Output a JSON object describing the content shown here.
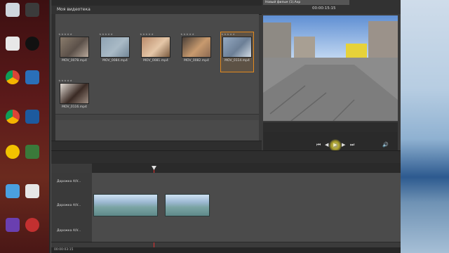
{
  "app": {
    "library_title": "Моя видеотека",
    "player_tab": "Новый фильм (1).Axp",
    "timecode": "00:00:15:15"
  },
  "library": {
    "items": [
      {
        "name": "MOV_0078.mp4",
        "stars": "★★★★★",
        "colors": [
          "#8a7c6c",
          "#5b5049",
          "#b8a89a"
        ]
      },
      {
        "name": "MOV_0084.mp4",
        "stars": "★★★★★",
        "colors": [
          "#8fa3b3",
          "#a9bac6",
          "#738797"
        ]
      },
      {
        "name": "MOV_0081.mp4",
        "stars": "★★★★★",
        "colors": [
          "#b98a6a",
          "#e5c7a8",
          "#7a5a3e"
        ]
      },
      {
        "name": "MOV_0082.mp4",
        "stars": "★★★★★",
        "colors": [
          "#4a3f38",
          "#c89a6e",
          "#8c6a52"
        ]
      },
      {
        "name": "MOV_0114.mp4",
        "stars": "★★★★★",
        "colors": [
          "#94a9c2",
          "#6c7f96",
          "#d2dbe4"
        ],
        "selected": true
      },
      {
        "name": "MOV_0116.mp4",
        "stars": "★★★★★",
        "colors": [
          "#e3ddd6",
          "#3a2a24",
          "#9b8b80"
        ]
      }
    ]
  },
  "timeline": {
    "tracks": [
      {
        "name": "Дорожка A/V...",
        "label": "track-1"
      },
      {
        "name": "Дорожка A/V...",
        "label": "track-2"
      },
      {
        "name": "Дорожка A/V...",
        "label": "track-3"
      }
    ],
    "bottom_time": "00:00:03:15"
  }
}
